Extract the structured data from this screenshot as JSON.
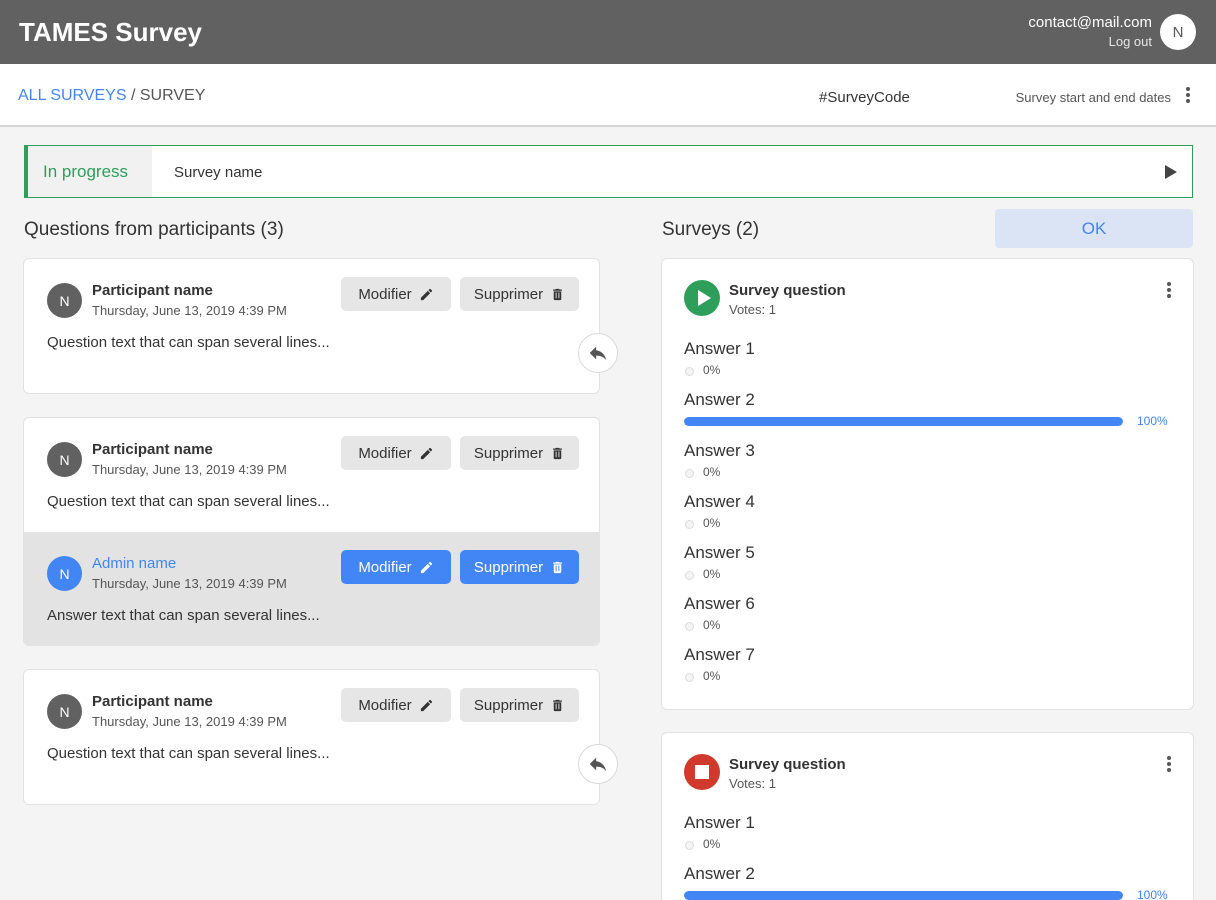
{
  "app": {
    "title": "TAMES Survey",
    "user_email": "contact@mail.com",
    "logout_label": "Log out",
    "user_initial": "N"
  },
  "breadcrumb": {
    "link": "ALL SURVEYS",
    "separator": "/",
    "current": "SURVEY"
  },
  "header": {
    "survey_code": "#SurveyCode",
    "dates_label": "Survey start and end dates"
  },
  "status": {
    "label": "In progress",
    "survey_name": "Survey name"
  },
  "questions_section": {
    "title": "Questions from participants (3)",
    "modify_label": "Modifier",
    "delete_label": "Supprimer",
    "items": [
      {
        "initial": "N",
        "name": "Participant name",
        "date": "Thursday, June 13, 2019 4:39 PM",
        "text": "Question text that can span several lines..."
      },
      {
        "initial": "N",
        "name": "Participant name",
        "date": "Thursday, June 13, 2019 4:39 PM",
        "text": "Question text that can span several lines...",
        "answer": {
          "initial": "N",
          "name": "Admin name",
          "date": "Thursday, June 13, 2019 4:39 PM",
          "text": "Answer text that can span several lines..."
        }
      },
      {
        "initial": "N",
        "name": "Participant name",
        "date": "Thursday, June 13, 2019 4:39 PM",
        "text": "Question text that can span several lines..."
      }
    ]
  },
  "surveys_section": {
    "title": "Surveys (2)",
    "ok_label": "OK",
    "cards": [
      {
        "state": "running",
        "state_color": "#2e9e5b",
        "question": "Survey question",
        "votes": "Votes: 1",
        "answers": [
          {
            "label": "Answer 1",
            "percent": "0%",
            "fraction": 0
          },
          {
            "label": "Answer 2",
            "percent": "100%",
            "fraction": 1
          },
          {
            "label": "Answer 3",
            "percent": "0%",
            "fraction": 0
          },
          {
            "label": "Answer 4",
            "percent": "0%",
            "fraction": 0
          },
          {
            "label": "Answer 5",
            "percent": "0%",
            "fraction": 0
          },
          {
            "label": "Answer 6",
            "percent": "0%",
            "fraction": 0
          },
          {
            "label": "Answer 7",
            "percent": "0%",
            "fraction": 0
          }
        ]
      },
      {
        "state": "stopped",
        "state_color": "#d0392b",
        "question": "Survey question",
        "votes": "Votes: 1",
        "answers": [
          {
            "label": "Answer 1",
            "percent": "0%",
            "fraction": 0
          },
          {
            "label": "Answer 2",
            "percent": "100%",
            "fraction": 1
          }
        ]
      }
    ]
  },
  "colors": {
    "accent": "#4285f4",
    "topbar": "#616161",
    "in_progress": "#2e9e5b"
  },
  "icons": {
    "edit": "pencil-icon",
    "delete": "trash-icon",
    "reply": "reply-icon",
    "menu": "kebab-menu-icon",
    "play": "play-icon",
    "stop": "stop-icon"
  }
}
